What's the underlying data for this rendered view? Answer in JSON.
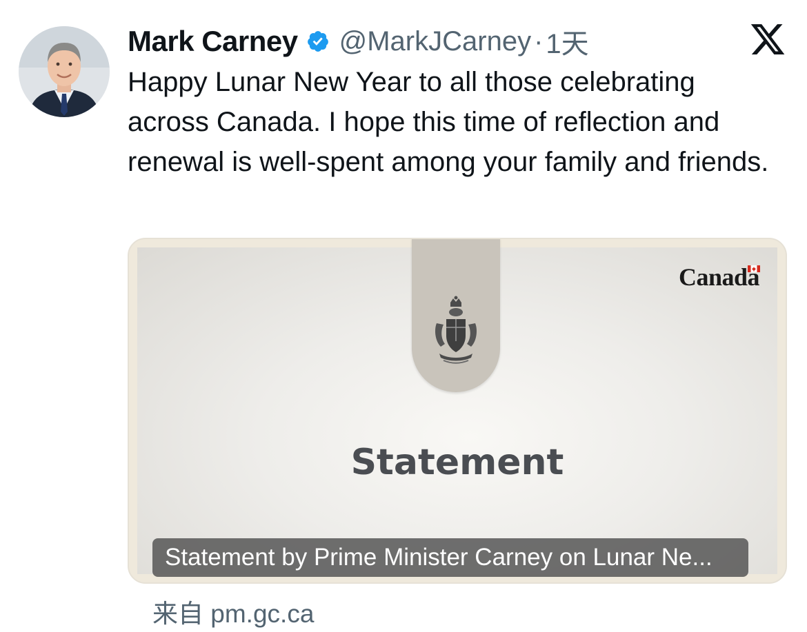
{
  "author": {
    "display_name": "Mark Carney",
    "handle": "@MarkJCarney",
    "separator": "·",
    "time": "1天",
    "verified_icon": "verified-badge-icon",
    "verified_color": "#1d9bf0"
  },
  "platform_icon": "x-logo-icon",
  "tweet": {
    "text": "Happy Lunar New Year to all those celebrating across Canada. I hope this time of reflection and renewal is well-spent among your family and friends."
  },
  "card": {
    "wordmark": "Canada",
    "heading": "Statement",
    "caption": "Statement by Prime Minister Carney on Lunar Ne...",
    "crest_icon": "coat-of-arms-icon",
    "flag_icon": "canada-flag-icon"
  },
  "source": {
    "text": "来自 pm.gc.ca"
  },
  "colors": {
    "text_primary": "#0f1419",
    "text_secondary": "#536471"
  }
}
